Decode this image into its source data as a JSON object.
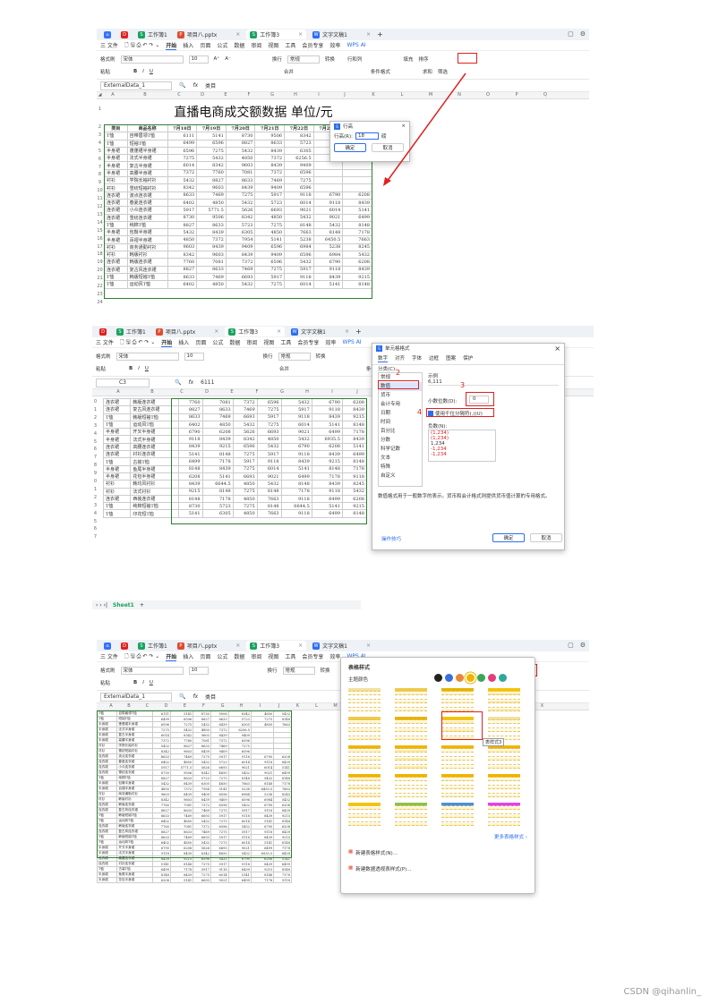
{
  "tabs": [
    {
      "label": "工作簿1",
      "icon": "spreadsheet-icon"
    },
    {
      "label": "项目八.pptx",
      "icon": "presentation-icon"
    },
    {
      "label": "工作簿3",
      "icon": "spreadsheet-icon"
    },
    {
      "label": "文字文稿1",
      "icon": "document-icon"
    }
  ],
  "menu": [
    "三 文件",
    "开始",
    "插入",
    "页面",
    "公式",
    "数据",
    "审阅",
    "视图",
    "工具",
    "会员专享",
    "效率",
    "WPS AI"
  ],
  "ribbon": {
    "row1": [
      "格式刷",
      "宋体",
      "10",
      "A⁺",
      "A⁻",
      "换行",
      "常规",
      "转换",
      "行和列",
      "填充",
      "排序"
    ],
    "row2": [
      "粘贴",
      "B",
      "I",
      "U",
      "合并",
      "条件格式",
      "求和",
      "筛选"
    ]
  },
  "panel1": {
    "namebox": "ExternalData_1",
    "formula": "类目",
    "cols": [
      "A",
      "B",
      "C",
      "D",
      "E",
      "F",
      "G",
      "H",
      "I",
      "J",
      "K",
      "L",
      "M",
      "N",
      "O",
      "P",
      "Q"
    ],
    "title": "直播电商成交额数据  单位/元",
    "headers": [
      "类目",
      "商品名称",
      "7月18日",
      "7月19日",
      "7月20日",
      "7月21日",
      "7月22日",
      "7月23日",
      "7月24日"
    ],
    "rows": [
      [
        "T恤",
        "自带眉领T恤",
        "6111",
        "5141",
        "8730",
        "9506",
        "8342",
        "4850",
        "5432"
      ],
      [
        "T恤",
        "短袖T恤",
        "6499",
        "6596",
        "8827",
        "8633",
        "5723",
        "7275",
        "8148"
      ],
      [
        "半身裙",
        "蓬蓬裙半身裙",
        "6596",
        "7275",
        "5432",
        "8439",
        "6305",
        "4850",
        "7663"
      ],
      [
        "半身裙",
        "法式半身裙",
        "7275",
        "5432",
        "4850",
        "7372",
        "6256.5",
        "",
        ""
      ],
      [
        "半身裙",
        "复古半身裙",
        "6014",
        "8342",
        "9603",
        "8439",
        "9409",
        "",
        ""
      ],
      [
        "半身裙",
        "高腰半身裙",
        "7372",
        "7760",
        "7081",
        "7372",
        "6596",
        "",
        ""
      ],
      [
        "衬衫",
        "学院长袖衬衫",
        "5432",
        "8827",
        "8633",
        "7469",
        "7275",
        "",
        ""
      ],
      [
        "衬衫",
        "雪纺短袖衬衫",
        "8342",
        "9603",
        "8439",
        "9409",
        "6596",
        "",
        ""
      ],
      [
        "连衣裙",
        "波点连衣裙",
        "8633",
        "7469",
        "7275",
        "5917",
        "9118",
        "6790",
        "6208"
      ],
      [
        "连衣裙",
        "春夏连衣裙",
        "6402",
        "4850",
        "5432",
        "5723",
        "6014",
        "9118",
        "8439"
      ],
      [
        "连衣裙",
        "小众连衣裙",
        "5917",
        "5771.5",
        "5626",
        "6693",
        "9021",
        "6014",
        "5141"
      ],
      [
        "连衣裙",
        "雪纺连衣裙",
        "8730",
        "9506",
        "8342",
        "4850",
        "5432",
        "9021",
        "6499"
      ],
      [
        "T恤",
        "纯棉T恤",
        "8827",
        "8633",
        "5723",
        "7275",
        "8148",
        "5432",
        "8148"
      ],
      [
        "半身裙",
        "包臀半身裙",
        "5432",
        "8439",
        "6305",
        "4850",
        "7663",
        "8148",
        "7178"
      ],
      [
        "半身裙",
        "百褶半身裙",
        "4850",
        "7372",
        "7954",
        "5141",
        "5238",
        "6450.5",
        "7663"
      ],
      [
        "衬衫",
        "商务通勤衬衫",
        "9603",
        "8439",
        "9409",
        "6596",
        "6984",
        "5238",
        "8245"
      ],
      [
        "衬衫",
        "韩版衬衫",
        "8342",
        "9603",
        "8439",
        "9409",
        "6596",
        "6984",
        "5432"
      ],
      [
        "连衣裙",
        "韩版连衣裙",
        "7760",
        "7081",
        "7372",
        "6596",
        "5432",
        "6790",
        "6208"
      ],
      [
        "连衣裙",
        "复古风连衣裙",
        "8827",
        "8633",
        "7469",
        "7275",
        "5917",
        "9118",
        "8439"
      ],
      [
        "T恤",
        "韩版短袖T恤",
        "8633",
        "7469",
        "6693",
        "5917",
        "9118",
        "8439",
        "9215"
      ],
      [
        "T恤",
        "运动风T恤",
        "6402",
        "4850",
        "5432",
        "7275",
        "6014",
        "5141",
        "8148"
      ]
    ],
    "dialog": {
      "title": "行高",
      "label": "行高(R):",
      "value": "18",
      "unit": "磅",
      "ok": "确定",
      "cancel": "取消"
    }
  },
  "panel2": {
    "namebox": "C3",
    "formula": "6111",
    "rownums": [
      "0",
      "1",
      "2",
      "3",
      "4",
      "5",
      "6",
      "7",
      "8",
      "9",
      "0",
      "1",
      "2",
      "3",
      "4",
      "5",
      "6",
      "7"
    ],
    "rows": [
      [
        "连衣裙",
        "韩版连衣裙",
        "7760",
        "7081",
        "7372",
        "6596",
        "5432",
        "6790",
        "6208"
      ],
      [
        "连衣裙",
        "复古风连衣裙",
        "8827",
        "8633",
        "7469",
        "7275",
        "5917",
        "9118",
        "8439"
      ],
      [
        "T恤",
        "韩版短袖T恤",
        "8633",
        "7469",
        "6693",
        "5917",
        "9118",
        "8439",
        "9215"
      ],
      [
        "T恤",
        "运动风T恤",
        "6402",
        "4850",
        "5432",
        "7275",
        "6014",
        "5141",
        "8148"
      ],
      [
        "半身裙",
        "开叉半身裙",
        "6790",
        "6208",
        "5626",
        "6693",
        "9021",
        "6499",
        "7178"
      ],
      [
        "半身裙",
        "法式半身裙",
        "9118",
        "8439",
        "8342",
        "4850",
        "5432",
        "6935.5",
        "8439"
      ],
      [
        "连衣裙",
        "高腰连衣裙",
        "8439",
        "9215",
        "6596",
        "5432",
        "6790",
        "6208",
        "5141"
      ],
      [
        "连衣裙",
        "衬衫连衣裙",
        "5141",
        "8148",
        "7275",
        "5917",
        "9118",
        "8439",
        "6499"
      ],
      [
        "T恤",
        "古装T恤",
        "6499",
        "7178",
        "5917",
        "9118",
        "8439",
        "9215",
        "8148"
      ],
      [
        "半身裙",
        "鱼尾半身裙",
        "8148",
        "8439",
        "7275",
        "6014",
        "5141",
        "8148",
        "7178"
      ],
      [
        "半身裙",
        "花包半身裙",
        "6208",
        "5141",
        "6693",
        "9021",
        "6499",
        "7178",
        "9118"
      ],
      [
        "衬衫",
        "韩均风衬衫",
        "8439",
        "6644.5",
        "4850",
        "5432",
        "8148",
        "8439",
        "8245"
      ],
      [
        "衬衫",
        "法式衬衫",
        "9215",
        "8148",
        "7275",
        "8148",
        "7178",
        "9118",
        "5432"
      ],
      [
        "连衣裙",
        "西装连衣裙",
        "8148",
        "7178",
        "4850",
        "7663",
        "9118",
        "6499",
        "6208"
      ],
      [
        "T恤",
        "纯棉短袖T恤",
        "8730",
        "5723",
        "7275",
        "8148",
        "6644.5",
        "5141",
        "9215"
      ],
      [
        "T恤",
        "印花短T恤",
        "5141",
        "6305",
        "4850",
        "7663",
        "9118",
        "6499",
        "8148"
      ]
    ],
    "sheet_tab": "Sheet1",
    "dialog": {
      "title": "单元格格式",
      "tabs": [
        "数字",
        "对齐",
        "字体",
        "边框",
        "图案",
        "保护"
      ],
      "category_label": "分类(C):",
      "categories": [
        "常规",
        "数值",
        "货币",
        "会计专用",
        "日期",
        "时间",
        "百分比",
        "分数",
        "科学记数",
        "文本",
        "特殊",
        "自定义"
      ],
      "sample_label": "示例",
      "sample": "6,111",
      "decimal_label": "小数位数(D):",
      "decimal_value": "0",
      "thousands_label": "使用千位分隔符(,)(U)",
      "neg_label": "负数(N):",
      "neg_options": [
        "(1,234)",
        "(1,234)",
        "1,234",
        "-1,234",
        "-1,234"
      ],
      "desc": "数值格式用于一般数字的表示。货币和会计格式则提供货币值计算的专用格式。",
      "tips": "操作技巧",
      "ok": "确定",
      "cancel": "取消"
    },
    "annotations": [
      "1",
      "2",
      "3",
      "4"
    ]
  },
  "panel3": {
    "namebox": "ExternalData_1",
    "formula": "类目",
    "popup": {
      "title": "表格样式",
      "theme_label": "主题颜色",
      "tooltip": "表样式3",
      "more": "更多表格样式 ›",
      "new_table_style": "新建表格样式(N)...",
      "new_pivot_style": "新建数据透视表样式(P)..."
    },
    "theme_colors": [
      "#222222",
      "#3b6fd9",
      "#e8873a",
      "#f0b400",
      "#3aa657",
      "#e0407a",
      "#2fa89a"
    ]
  },
  "footer": "CSDN @qihanlin_"
}
